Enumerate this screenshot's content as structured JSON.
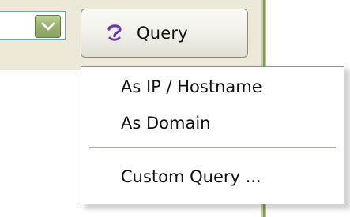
{
  "combo": {
    "arrow_icon": "chevron-down-icon"
  },
  "query_button": {
    "label": "Query",
    "icon": "query-icon"
  },
  "menu": {
    "items": [
      {
        "label": "As IP / Hostname"
      },
      {
        "label": "As Domain"
      },
      {
        "label": "Custom Query ..."
      }
    ]
  },
  "colors": {
    "toolbar_bg": "#ece9d8",
    "combo_arrow": "#9ab36e",
    "icon_purple": "#6a3aa0",
    "menu_border": "#8f8f8f"
  }
}
